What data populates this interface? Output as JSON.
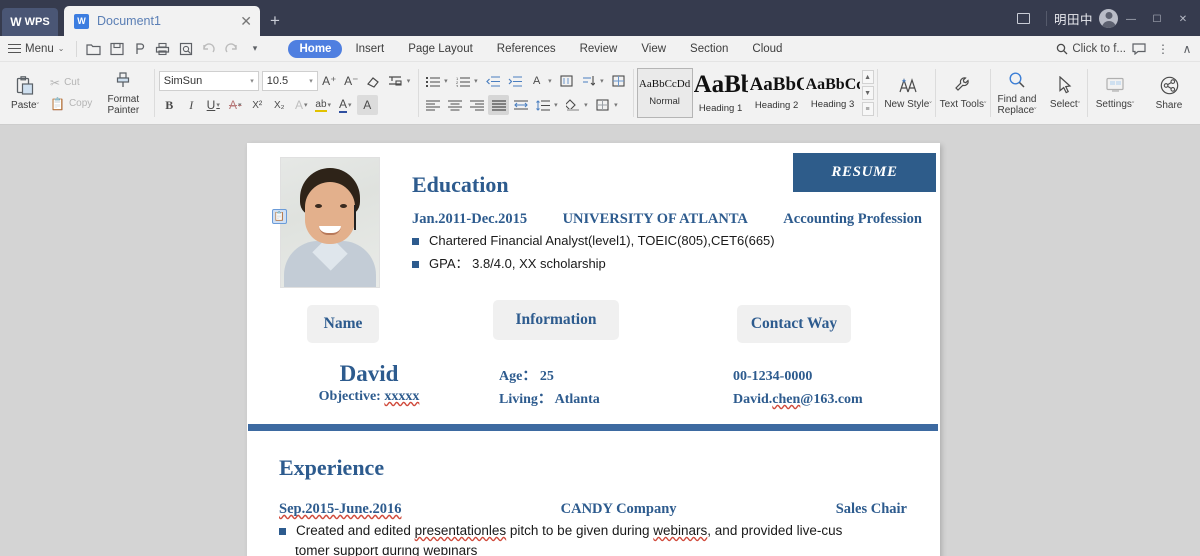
{
  "titlebar": {
    "app_badge": "WPS",
    "tab_name": "Document1",
    "close_label": "✕",
    "new_tab_label": "+",
    "user_name": "明田中",
    "minimize": "—",
    "maximize": "☐",
    "close_win": "✕"
  },
  "quickaccess": {
    "menu_label": "Menu",
    "caret": "⌄",
    "items": [
      {
        "name": "open-file",
        "glyph": "📂"
      },
      {
        "name": "save",
        "glyph": "💾"
      },
      {
        "name": "output-pdf",
        "glyph": "⎙"
      },
      {
        "name": "print",
        "glyph": "⎙"
      },
      {
        "name": "print-preview",
        "glyph": "🔍"
      },
      {
        "name": "undo",
        "glyph": "↶"
      },
      {
        "name": "redo",
        "glyph": "↷"
      },
      {
        "name": "customize",
        "glyph": "⌄"
      }
    ]
  },
  "ribbon_tabs": [
    {
      "label": "Home",
      "active": true
    },
    {
      "label": "Insert",
      "active": false
    },
    {
      "label": "Page Layout",
      "active": false
    },
    {
      "label": "References",
      "active": false
    },
    {
      "label": "Review",
      "active": false
    },
    {
      "label": "View",
      "active": false
    },
    {
      "label": "Section",
      "active": false
    },
    {
      "label": "Cloud",
      "active": false
    }
  ],
  "search": {
    "label": "Click to f...",
    "icon": "🔍",
    "comment_icon": "💬",
    "more_icon": "⋮",
    "collapse_icon": "∧"
  },
  "ribbon": {
    "clipboard": {
      "paste_label": "Paste",
      "paste_caret": "ˇ",
      "cut_label": "Cut",
      "copy_label": "Copy",
      "format_painter_label": "Format\nPainter"
    },
    "font": {
      "family_value": "SimSun",
      "size_value": "10.5",
      "grow_font": "A⁺",
      "shrink_font": "A⁻",
      "clear_format": "◇",
      "pinyin_guide": "⨍",
      "char_border": "A",
      "bold": "B",
      "italic": "I",
      "underline": "U",
      "strikethrough": "A",
      "superscript": "X²",
      "subscript": "X₂",
      "text_effects": "A",
      "highlight": "ab",
      "font_color": "A",
      "char_shading": "A"
    },
    "paragraph": {
      "bullet_list": "≡",
      "numbered_list": "≡",
      "decrease_indent": "←≡",
      "increase_indent": "→≡",
      "asian_layout": "A",
      "pinyin": "☰",
      "sort": "⇅",
      "show_marks": "¶",
      "align_left": "≡",
      "align_center": "≡",
      "align_right": "≡",
      "justify": "≡",
      "distribute": "↔",
      "line_spacing": "↕≡",
      "shading": "◇",
      "borders": "⊞"
    },
    "styles": [
      {
        "preview": "AaBbCcDd",
        "label": "Normal",
        "selected": true
      },
      {
        "preview": "AaBb",
        "label": "Heading 1",
        "selected": false
      },
      {
        "preview": "AaBbC",
        "label": "Heading 2",
        "selected": false
      },
      {
        "preview": "AaBbCc",
        "label": "Heading 3",
        "selected": false
      }
    ],
    "gallery_nav": {
      "up": "▲",
      "down": "▼",
      "more": "≡"
    },
    "tools": [
      {
        "label": "New Style",
        "glyph": "АА",
        "caret": "ˇ",
        "name": "new-style-button"
      },
      {
        "label": "Text Tools",
        "glyph": "🔧",
        "caret": "ˇ",
        "name": "text-tools-button"
      },
      {
        "label": "Find and\nReplace",
        "glyph": "🔍",
        "caret": "ˇ",
        "name": "find-and-replace-button"
      },
      {
        "label": "Select",
        "glyph": "➤",
        "caret": "ˇ",
        "name": "select-button"
      },
      {
        "label": "Settings",
        "glyph": "⚙",
        "caret": "ˇ",
        "name": "settings-button"
      },
      {
        "label": "Share",
        "glyph": "⍤",
        "caret": "",
        "name": "share-button"
      }
    ]
  },
  "document": {
    "banner_title": "RESUME",
    "education": {
      "heading": "Education",
      "period": "Jan.2011-Dec.2015",
      "school": "UNIVERSITY OF ATLANTA",
      "major": "Accounting Profession",
      "bullets": [
        "Chartered Financial Analyst(level1), TOEIC(805),CET6(665)",
        "GPA： 3.8/4.0, XX scholarship"
      ]
    },
    "chips": {
      "name": "Name",
      "information": "Information",
      "contact": "Contact Way"
    },
    "profile": {
      "name": "David",
      "objective_label": "Objective:",
      "objective_value": "xxxxx",
      "age": "Age： 25",
      "living": "Living： Atlanta",
      "phone": "00-1234-0000",
      "email_user": "David.",
      "email_mis": "chen",
      "email_rest": "@163.com"
    },
    "experience": {
      "heading": "Experience",
      "period": "Sep.2015-June.2016",
      "company": "CANDY Company",
      "role": "Sales Chair",
      "bullet_pre": "Created and edited ",
      "bullet_mis1": "presentationles",
      "bullet_mid": " pitch to be given during ",
      "bullet_mis2": "webinars",
      "bullet_post": ", and provided live-cus",
      "cut_text": "tomer support during webinars"
    }
  }
}
